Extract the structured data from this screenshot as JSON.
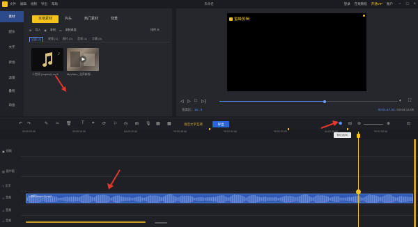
{
  "app": {
    "title": "未命名",
    "menu": [
      "文件",
      "编辑",
      "视频",
      "导出",
      "帮助"
    ],
    "right_links": [
      "登录",
      "在线教程",
      "开通VIP",
      "账户"
    ],
    "storage": "剩余时长 13:07"
  },
  "sidebar": {
    "items": [
      {
        "label": "素材",
        "active": true
      },
      {
        "label": "配乐",
        "active": false
      },
      {
        "label": "文字",
        "active": false
      },
      {
        "label": "转场",
        "active": false
      },
      {
        "label": "滤镜",
        "active": false
      },
      {
        "label": "叠附",
        "active": false
      },
      {
        "label": "动画",
        "active": false
      }
    ]
  },
  "media": {
    "tabs": [
      "本地素材",
      "片头",
      "热门素材",
      "背景"
    ],
    "import_label": "导入",
    "record_label": "录制",
    "screen_record_label": "录制桌面",
    "sort_label": "排序",
    "filters": [
      "全部 (2)",
      "视频 (1)",
      "图片 (0)",
      "音频 (1)",
      "字幕 (0)"
    ],
    "items": [
      {
        "name": "人世间 (mqms2).mp3",
        "kind": "audio",
        "icon": "music-note-icon"
      },
      {
        "name": "MyVideo_北声新视...",
        "kind": "video",
        "icon": "video-thumbnail"
      }
    ]
  },
  "preview": {
    "watermark": "蜜蜂剪辑",
    "ratio_label": "宽高比：",
    "ratio_value": "16 : 9",
    "current_time": "00:01:47.02",
    "total_time": "/ 00:04:14.05",
    "progress": 0.59
  },
  "toolbar": {
    "subtitle_label": "语音文字互转",
    "export_label": "导出",
    "tools": [
      "undo-icon",
      "redo-icon",
      "pen-icon",
      "scissors-icon",
      "trash-icon",
      "text-icon",
      "crop-icon",
      "rotate-icon",
      "speed-icon",
      "clock-icon",
      "mic-icon",
      "freeze-icon",
      "mosaic-icon",
      "split-icon",
      "zoom-out-icon",
      "zoom-in-icon"
    ]
  },
  "timeline": {
    "ticks": [
      "00:00:00.00",
      "00:00:16.00",
      "00:00:32.00",
      "00:00:48.00",
      "00:01:04.00",
      "00:01:20.00",
      "00:01:36.00",
      "00:01:52.00"
    ],
    "tooltip": "标记点(M)",
    "tracks": [
      {
        "label": "视频",
        "icon": "video-track-icon"
      },
      {
        "label": "画中画",
        "icon": "pip-track-icon"
      },
      {
        "label": "文字",
        "icon": "text-track-icon"
      },
      {
        "label": "音频",
        "icon": "audio-track-icon"
      },
      {
        "label": "音频",
        "icon": "audio-track-icon"
      },
      {
        "label": "音频",
        "icon": "audio-track-icon"
      }
    ],
    "audio_clip": "人世间 (mqms2).mp3"
  },
  "colors": {
    "accent": "#f4c21a",
    "primary": "#2a66d6",
    "annotation": "#e4382e"
  }
}
